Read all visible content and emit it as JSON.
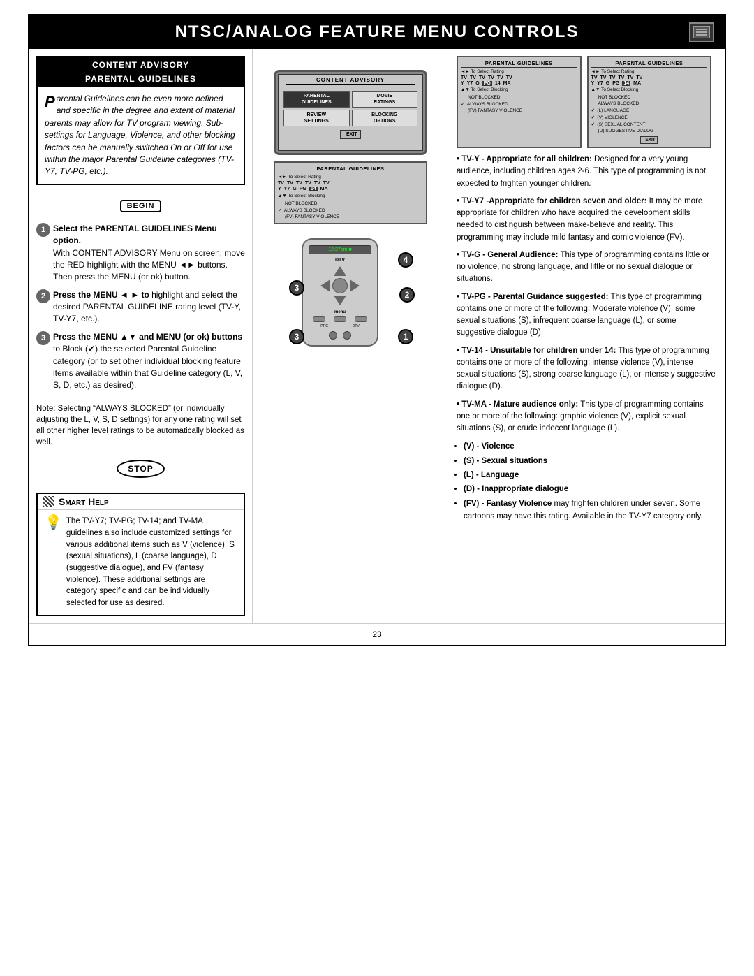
{
  "header": {
    "title": "NTSC/Analog Feature Menu Controls",
    "title_display": "NTSC/A​NALOG F​EATURE M​ENU C​ONTROLS"
  },
  "left_section": {
    "advisory_header": "CONTENT ADVISORY",
    "advisory_subheader": "PARENTAL GUIDELINES",
    "advisory_body": "arental Guidelines can be even more defined and specific in the degree and extent of material parents may allow for TV program viewing. Sub-settings for Language, Violence, and other blocking factors can be manually switched On or Off for use within the major Parental Guideline categories (TV-Y7, TV-PG, etc.).",
    "begin_label": "BEGIN",
    "stop_label": "STOP",
    "step1_title": "Select the PARENTAL GUIDELINES Menu option.",
    "step1_detail": "With CONTENT ADVISORY Menu on screen, move the RED highlight with the MENU ◄► buttons. Then press the MENU (or ok) button.",
    "step2_title": "Press the MENU ◄ ► to highlight and select the desired PARENTAL GUIDELINE rating level (TV-Y, TV-Y7, etc.).",
    "step3_title": "Press the MENU ▲▼ and MENU (or ok) buttons to Block (✓) the selected Parental Guideline category (or to set other individual blocking feature items available within that Guideline category (L, V, S, D, etc.) as desired).",
    "note": "Note: Selecting “ALWAYS BLOCKED” (or individually adjusting the L, V, S, D settings) for any one rating will set all other higher level ratings to be automatically blocked as well.",
    "smart_help_header": "Smart Help",
    "smart_help_body": "The TV-Y7; TV-PG; TV-14; and TV-MA guidelines also include customized settings for various additional items such as V (violence), S (sexual situations), L (coarse language), D (suggestive dialogue), and FV (fantasy violence). These additional settings are category specific and can be individually selected for use as desired."
  },
  "middle_section": {
    "content_advisory_menu_label": "CONTENT ADVISORY",
    "menu_items": [
      {
        "label": "PARENTAL\nGUIDELINES",
        "selected": true
      },
      {
        "label": "MOVIE\nRATINGS"
      },
      {
        "label": "REVIEW\nSETTINGS"
      },
      {
        "label": "BLOCKING\nOPTIONS"
      }
    ],
    "exit_label": "EXIT",
    "pg_screen1": {
      "title": "PARENTAL GUIDELINES",
      "nav_hint_lr": "◄► To Select Rating",
      "nav_hint_ud": "▲▼ To Select Blocking",
      "ratings": [
        "TV",
        "TV",
        "TV",
        "TV",
        "TV",
        "TV"
      ],
      "ratings_sub": [
        "Y",
        "Y7",
        "G",
        "PG",
        "14",
        "MA"
      ],
      "pg14_highlighted": true,
      "blocking_items": [
        {
          "label": "NOT BLOCKED",
          "checked": false
        },
        {
          "label": "ALWAYS BLOCKED",
          "checked": true
        },
        {
          "label": "(FV) FANTASY VIOLENCE",
          "checked": false
        }
      ]
    },
    "pg_screen2": {
      "title": "PARENTAL GUIDELINES",
      "nav_hint_lr": "◄► To Select Rating",
      "nav_hint_ud": "▲▼ To Select Blocking",
      "ratings": [
        "TV",
        "TV",
        "TV",
        "TV",
        "TV",
        "TV"
      ],
      "ratings_sub": [
        "Y",
        "Y7",
        "G",
        "PG",
        "14",
        "MA"
      ],
      "blocking_items": [
        {
          "label": "NOT BLOCKED",
          "checked": false
        },
        {
          "label": "ALWAYS BLOCKED",
          "checked": false
        },
        {
          "label": "(L) LANGUAGE",
          "checked": true
        },
        {
          "label": "(V) VIOLENCE",
          "checked": true
        },
        {
          "label": "(S) SEXUAL CONTENT",
          "checked": true
        },
        {
          "label": "(D) SUGGESTIVE DIALOG",
          "checked": false
        }
      ]
    }
  },
  "right_section": {
    "tv_y_label": "TV-Y",
    "tv_y_text": "TV-Y - Appropriate for all children: Designed for a very young audience, including children ages 2-6. This type of programming is not expected to frighten younger children.",
    "tv_y7_label": "TV-Y7",
    "tv_y7_text": "TV-Y7 -Appropriate for children seven and older: It may be more appropriate for children who have acquired the development skills needed to distinguish between make-believe and reality. This programming may include mild fantasy and comic violence (FV).",
    "tv_g_label": "TV-G",
    "tv_g_text": "TV-G - General Audience: This type of programming contains little or no violence, no strong language, and little or no sexual dialogue or situations.",
    "tv_pg_label": "TV-PG",
    "tv_pg_text": "TV-PG - Parental Guidance suggested: This type of programming contains one or more of the following: Moderate violence (V), some sexual situations (S), infrequent coarse language (L), or some suggestive dialogue (D).",
    "tv_14_label": "TV-14",
    "tv_14_text": "TV-14 - Unsuitable for children under 14: This type of programming contains one or more of the following: intense violence (V), intense sexual situations (S), strong coarse language (L), or intensely suggestive dialogue (D).",
    "tv_ma_label": "TV-MA",
    "tv_ma_text": "TV-MA - Mature audience only: This type of programming contains one or more of the following: graphic violence (V), explicit sexual situations (S), or crude indecent language (L).",
    "bullets": [
      "(V) - Violence",
      "(S) - Sexual situations",
      "(L) - Language",
      "(D) - Inappropriate dialogue",
      "(FV) - Fantasy Violence may frighten children under seven. Some cartoons may have this rating. Available in the TV-Y7 category only."
    ]
  },
  "page_number": "23"
}
